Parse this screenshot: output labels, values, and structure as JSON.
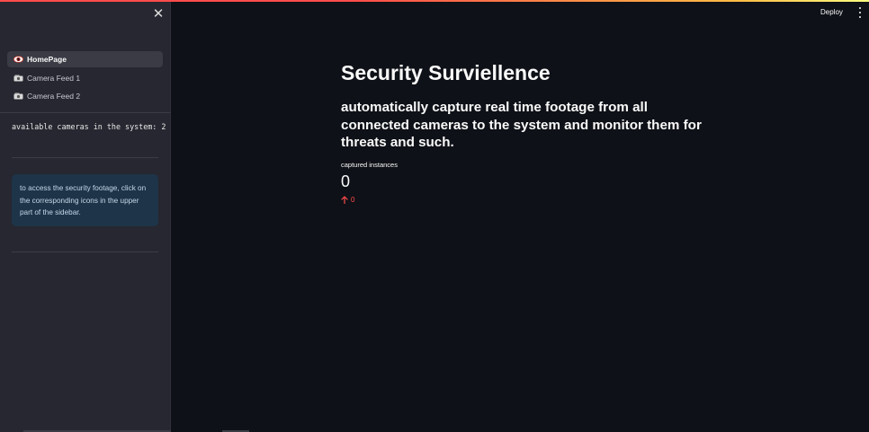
{
  "sidebar": {
    "nav": [
      {
        "label": "HomePage",
        "icon": "eye-icon",
        "active": true
      },
      {
        "label": "Camera Feed 1",
        "icon": "camera-icon",
        "active": false
      },
      {
        "label": "Camera Feed 2",
        "icon": "camera-icon",
        "active": false
      }
    ],
    "camera_count_text": "available cameras in the system: 2",
    "info_text": "to access the security footage, click on the corresponding icons in the upper part of the sidebar."
  },
  "header": {
    "deploy_label": "Deploy"
  },
  "main": {
    "title": "Security Surviellence",
    "subtitle": "automatically capture real time footage from all connected cameras to the system and monitor them for threats and such.",
    "metric": {
      "label": "captured instances",
      "value": "0",
      "delta": "0"
    }
  },
  "colors": {
    "background": "#0e1117",
    "sidebar": "#262730",
    "accent_red": "#ff4b4b",
    "info_box": "#1e3448"
  }
}
